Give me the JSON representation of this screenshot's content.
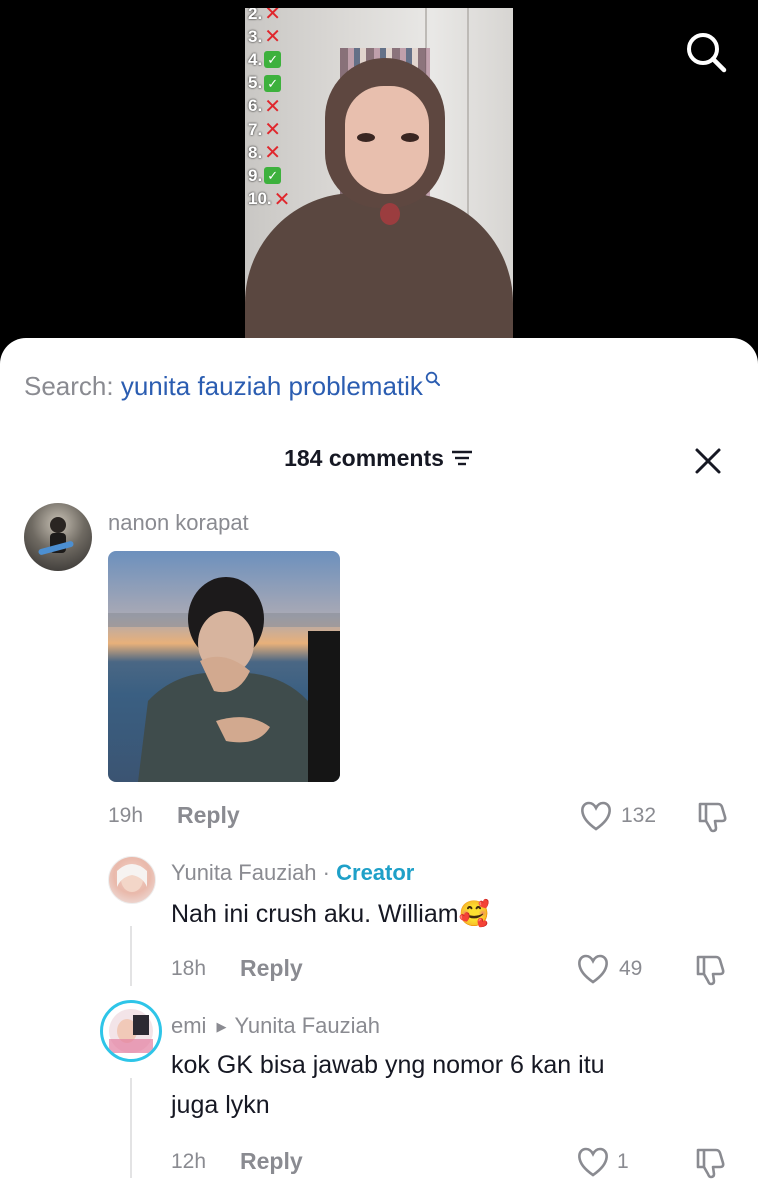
{
  "video": {
    "checklist": [
      {
        "label": "2.",
        "mark": "x"
      },
      {
        "label": "3.",
        "mark": "x"
      },
      {
        "label": "4.",
        "mark": "check"
      },
      {
        "label": "5.",
        "mark": "check"
      },
      {
        "label": "6.",
        "mark": "x"
      },
      {
        "label": "7.",
        "mark": "x"
      },
      {
        "label": "8.",
        "mark": "x"
      },
      {
        "label": "9.",
        "mark": "check"
      },
      {
        "label": "10.",
        "mark": "x"
      }
    ]
  },
  "search_bar": {
    "prefix": "Search:",
    "query": "yunita fauziah problematik"
  },
  "comments_header": {
    "count_label": "184 comments"
  },
  "comments": [
    {
      "username": "nanon korapat",
      "time": "19h",
      "reply_label": "Reply",
      "likes": "132"
    }
  ],
  "replies": [
    {
      "username": "Yunita Fauziah",
      "separator": "·",
      "badge": "Creator",
      "text": "Nah ini crush aku. William🥰",
      "time": "18h",
      "reply_label": "Reply",
      "likes": "49"
    },
    {
      "username": "emi",
      "reply_to": "Yunita Fauziah",
      "text_line1": "kok GK bisa jawab yng nomor 6 kan itu",
      "text_line2": "juga lykn",
      "time": "12h",
      "reply_label": "Reply",
      "likes": "1"
    }
  ],
  "colors": {
    "accent_link": "#2b5db1",
    "creator_badge": "#1ea0c8",
    "secondary_text": "#8a8b91",
    "primary_text": "#161823"
  }
}
